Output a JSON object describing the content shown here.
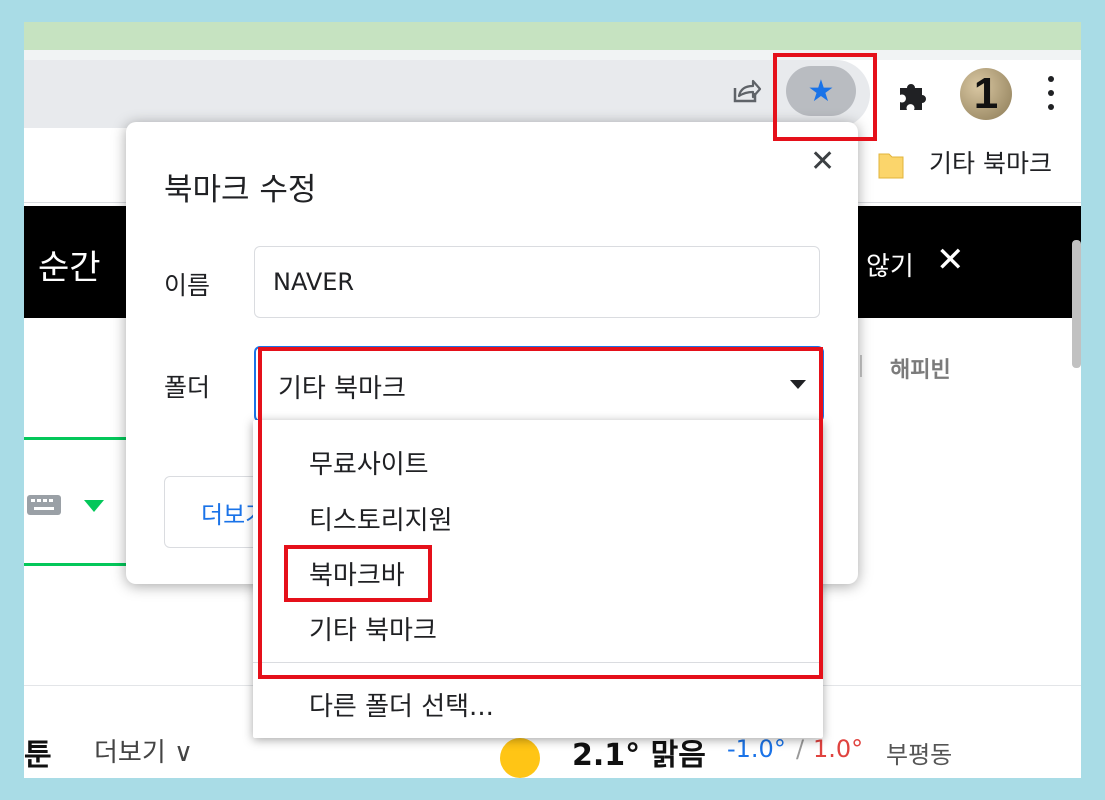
{
  "toolbar": {
    "share_icon": "share-icon",
    "star_icon": "star-icon",
    "star_glyph": "★",
    "extensions_icon": "puzzle-icon",
    "profile_label": "1",
    "menu_icon": "kebab-menu-icon"
  },
  "bookmarks_bar": {
    "other_bookmarks": "기타 북마크"
  },
  "page": {
    "band_left": "순간",
    "band_right": "않기",
    "band_close": "✕",
    "happybean": "해피빈",
    "bottom_tun": "툰",
    "bottom_more": "더보기 ∨",
    "temperature": "2.1° 맑음",
    "temp_low": "-1.0°",
    "temp_sep": "/",
    "temp_high": "1.0°",
    "location": "부평동"
  },
  "dialog": {
    "title": "북마크 수정",
    "close_glyph": "✕",
    "name_label": "이름",
    "name_value": "NAVER",
    "folder_label": "폴더",
    "folder_value": "기타 북마크",
    "more_button": "더보기"
  },
  "dropdown": {
    "items": [
      {
        "label": "무료사이트"
      },
      {
        "label": "티스토리지원"
      },
      {
        "label": "북마크바"
      },
      {
        "label": "기타 북마크"
      }
    ],
    "choose_other": "다른 폴더 선택..."
  },
  "colors": {
    "highlight": "#e5101a",
    "accent": "#1a73e8",
    "naver_green": "#03c75a"
  }
}
